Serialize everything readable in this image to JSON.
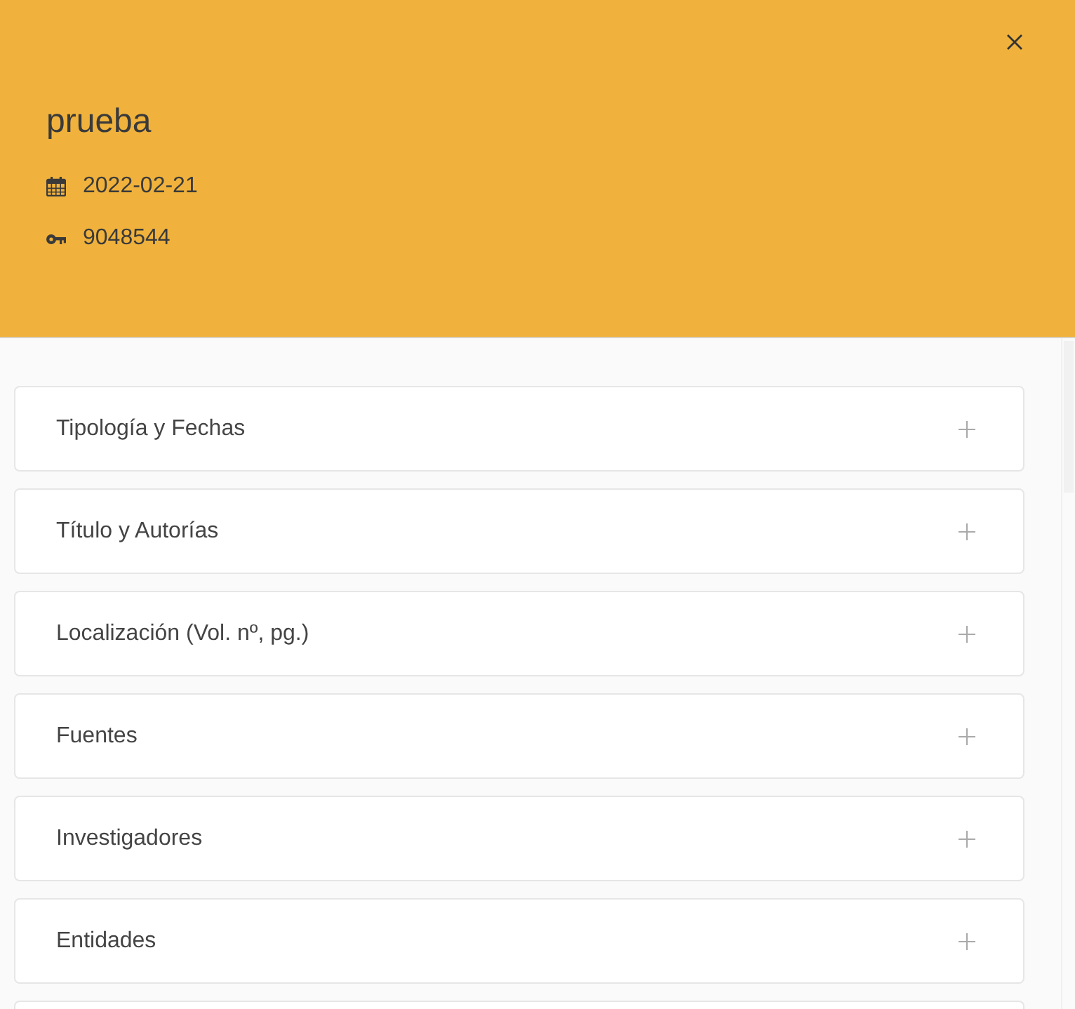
{
  "header": {
    "title": "prueba",
    "date": "2022-02-21",
    "key": "9048544"
  },
  "sections": [
    {
      "label": "Tipología y Fechas",
      "expanded": false
    },
    {
      "label": "Título y Autorías",
      "expanded": false
    },
    {
      "label": "Localización (Vol. nº, pg.)",
      "expanded": false
    },
    {
      "label": "Fuentes",
      "expanded": false
    },
    {
      "label": "Investigadores",
      "expanded": false
    },
    {
      "label": "Entidades",
      "expanded": false
    }
  ]
}
